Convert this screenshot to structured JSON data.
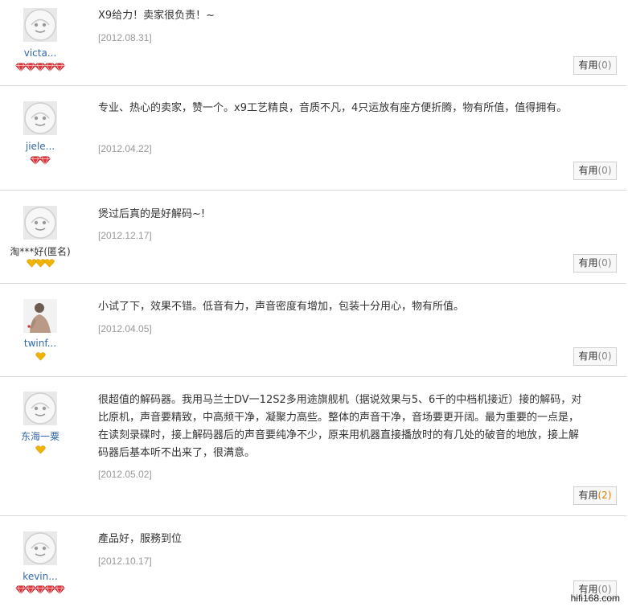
{
  "reviews": [
    {
      "username": "victa...",
      "text": "X9给力！卖家很负责！~",
      "date": "[2012.08.31]",
      "useful_label": "有用",
      "useful_count": "(0)",
      "badge_type": "diamond",
      "badge_count": 5,
      "avatar": "default-face"
    },
    {
      "username": "jiele...",
      "text": "专业、热心的卖家，赞一个。x9工艺精良，音质不凡，4只运放有座方便折腾，物有所值，值得拥有。",
      "date": "[2012.04.22]",
      "useful_label": "有用",
      "useful_count": "(0)",
      "badge_type": "diamond",
      "badge_count": 2,
      "avatar": "default-face"
    },
    {
      "username": "淘***好(匿名)",
      "text": "煲过后真的是好解码~!",
      "date": "[2012.12.17]",
      "useful_label": "有用",
      "useful_count": "(0)",
      "badge_type": "heart",
      "badge_count": 3,
      "avatar": "default-face"
    },
    {
      "username": "twinf...",
      "text": "小试了下，效果不错。低音有力，声音密度有增加，包装十分用心，物有所值。",
      "date": "[2012.04.05]",
      "useful_label": "有用",
      "useful_count": "(0)",
      "badge_type": "heart",
      "badge_count": 1,
      "avatar": "photo"
    },
    {
      "username": "东海一粟",
      "text": "很超值的解码器。我用马兰士DV一12S2多用途旗舰机（据说效果与5、6千的中档机接近）接的解码，对比原机，声音要精致，中高频干净，凝聚力高些。整体的声音干净，音场要更开阔。最为重要的一点是，在读刻录碟时，接上解码器后的声音要纯净不少，原来用机器直接播放时的有几处的破音的地放，接上解码器后基本听不出来了，很满意。",
      "date": "[2012.05.02]",
      "useful_label": "有用",
      "useful_count": "(2)",
      "badge_type": "heart",
      "badge_count": 1,
      "avatar": "default-face"
    },
    {
      "username": "kevin...",
      "text": "產品好，服務到位",
      "date": "[2012.10.17]",
      "useful_label": "有用",
      "useful_count": "(0)",
      "badge_type": "diamond",
      "badge_count": 5,
      "avatar": "default-face"
    }
  ],
  "watermark": "hifi168.com",
  "colors": {
    "username": "#3366aa",
    "date": "#999999",
    "divider": "#d9d9d9",
    "diamond": "#e0333a",
    "heart": "#f0b400",
    "useful_highlight": "#e67e00"
  }
}
